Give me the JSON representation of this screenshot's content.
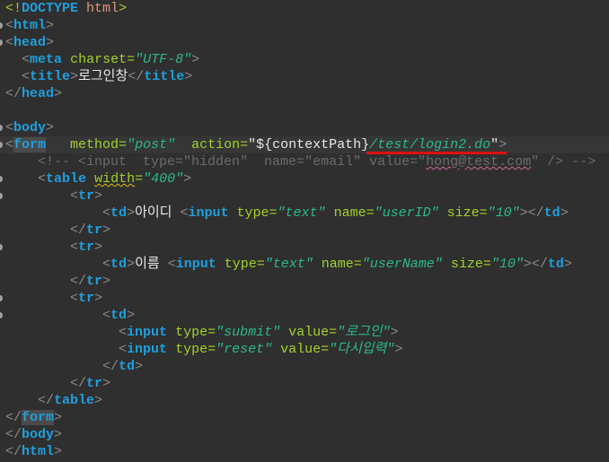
{
  "editor": {
    "current_line": 8,
    "fold_lines": [
      1,
      2,
      7,
      8,
      10,
      11,
      14,
      17,
      18
    ],
    "annotation": {
      "type": "red-underline",
      "color": "#e01010",
      "target": "/test/login2.do"
    },
    "colors": {
      "background": "#2f2f2f",
      "tag": "#1ea0de",
      "attribute": "#a3d12a",
      "value": "#2cb98e",
      "comment": "#6c6c6c",
      "bracket": "#8a8a8a"
    },
    "lines": [
      [
        [
          "dt1",
          "<!"
        ],
        [
          "dt2",
          "DOCTYPE"
        ],
        [
          "txt",
          " "
        ],
        [
          "dt3",
          "html"
        ],
        [
          "dt1",
          ">"
        ]
      ],
      [
        [
          "br",
          "<"
        ],
        [
          "tag",
          "html"
        ],
        [
          "br",
          ">"
        ]
      ],
      [
        [
          "br",
          "<"
        ],
        [
          "tag",
          "head"
        ],
        [
          "br",
          ">"
        ]
      ],
      [
        [
          "txt",
          "  "
        ],
        [
          "br",
          "<"
        ],
        [
          "tag",
          "meta"
        ],
        [
          "txt",
          " "
        ],
        [
          "attr",
          "charset="
        ],
        [
          "val",
          "\"UTF-8\""
        ],
        [
          "br",
          ">"
        ]
      ],
      [
        [
          "txt",
          "  "
        ],
        [
          "br",
          "<"
        ],
        [
          "tag",
          "title"
        ],
        [
          "br",
          ">"
        ],
        [
          "txt",
          "로그인창"
        ],
        [
          "br",
          "</"
        ],
        [
          "tag",
          "title"
        ],
        [
          "br",
          ">"
        ]
      ],
      [
        [
          "br",
          "</"
        ],
        [
          "tag",
          "head"
        ],
        [
          "br",
          ">"
        ]
      ],
      [],
      [
        [
          "br",
          "<"
        ],
        [
          "tag",
          "body"
        ],
        [
          "br",
          ">"
        ]
      ],
      [
        [
          "br",
          "<"
        ],
        [
          "tag match",
          "form"
        ],
        [
          "txt",
          "   "
        ],
        [
          "attr",
          "method="
        ],
        [
          "val",
          "\"post\""
        ],
        [
          "txt",
          "  "
        ],
        [
          "attr",
          "action="
        ],
        [
          "txt",
          "\"${contextPath}"
        ],
        [
          "val",
          "/test/login2.do"
        ],
        [
          "txt",
          "\""
        ],
        [
          "br",
          ">"
        ]
      ],
      [
        [
          "txt",
          "    "
        ],
        [
          "cm",
          "<!-- <input  type=\"hidden\"  name=\"email\" value=\""
        ],
        [
          "cm wavy-p",
          "hong@test.com"
        ],
        [
          "cm",
          "\" /> -->"
        ]
      ],
      [
        [
          "txt",
          "    "
        ],
        [
          "br",
          "<"
        ],
        [
          "tag",
          "table"
        ],
        [
          "txt",
          " "
        ],
        [
          "attr wavy-y",
          "width"
        ],
        [
          "attr",
          "="
        ],
        [
          "val",
          "\"400\""
        ],
        [
          "br",
          ">"
        ]
      ],
      [
        [
          "txt",
          "        "
        ],
        [
          "br",
          "<"
        ],
        [
          "tag",
          "tr"
        ],
        [
          "br",
          ">"
        ]
      ],
      [
        [
          "txt",
          "            "
        ],
        [
          "br",
          "<"
        ],
        [
          "tag",
          "td"
        ],
        [
          "br",
          ">"
        ],
        [
          "txt",
          "아이디 "
        ],
        [
          "br",
          "<"
        ],
        [
          "tag",
          "input"
        ],
        [
          "txt",
          " "
        ],
        [
          "attr",
          "type="
        ],
        [
          "val",
          "\"text\""
        ],
        [
          "txt",
          " "
        ],
        [
          "attr",
          "name="
        ],
        [
          "val",
          "\"userID\""
        ],
        [
          "txt",
          " "
        ],
        [
          "attr",
          "size="
        ],
        [
          "val",
          "\"10\""
        ],
        [
          "br",
          "></"
        ],
        [
          "tag",
          "td"
        ],
        [
          "br",
          ">"
        ]
      ],
      [
        [
          "txt",
          "        "
        ],
        [
          "br",
          "</"
        ],
        [
          "tag",
          "tr"
        ],
        [
          "br",
          ">"
        ]
      ],
      [
        [
          "txt",
          "        "
        ],
        [
          "br",
          "<"
        ],
        [
          "tag",
          "tr"
        ],
        [
          "br",
          ">"
        ]
      ],
      [
        [
          "txt",
          "            "
        ],
        [
          "br",
          "<"
        ],
        [
          "tag",
          "td"
        ],
        [
          "br",
          ">"
        ],
        [
          "txt",
          "이름 "
        ],
        [
          "br",
          "<"
        ],
        [
          "tag",
          "input"
        ],
        [
          "txt",
          " "
        ],
        [
          "attr",
          "type="
        ],
        [
          "val",
          "\"text\""
        ],
        [
          "txt",
          " "
        ],
        [
          "attr",
          "name="
        ],
        [
          "val",
          "\"userName\""
        ],
        [
          "txt",
          " "
        ],
        [
          "attr",
          "size="
        ],
        [
          "val",
          "\"10\""
        ],
        [
          "br",
          "></"
        ],
        [
          "tag",
          "td"
        ],
        [
          "br",
          ">"
        ]
      ],
      [
        [
          "txt",
          "        "
        ],
        [
          "br",
          "</"
        ],
        [
          "tag",
          "tr"
        ],
        [
          "br",
          ">"
        ]
      ],
      [
        [
          "txt",
          "        "
        ],
        [
          "br",
          "<"
        ],
        [
          "tag",
          "tr"
        ],
        [
          "br",
          ">"
        ]
      ],
      [
        [
          "txt",
          "            "
        ],
        [
          "br",
          "<"
        ],
        [
          "tag",
          "td"
        ],
        [
          "br",
          ">"
        ]
      ],
      [
        [
          "txt",
          "              "
        ],
        [
          "br",
          "<"
        ],
        [
          "tag",
          "input"
        ],
        [
          "txt",
          " "
        ],
        [
          "attr",
          "type="
        ],
        [
          "val",
          "\"submit\""
        ],
        [
          "txt",
          " "
        ],
        [
          "attr",
          "value="
        ],
        [
          "val",
          "\"로그인\""
        ],
        [
          "br",
          ">"
        ]
      ],
      [
        [
          "txt",
          "              "
        ],
        [
          "br",
          "<"
        ],
        [
          "tag",
          "input"
        ],
        [
          "txt",
          " "
        ],
        [
          "attr",
          "type="
        ],
        [
          "val",
          "\"reset\""
        ],
        [
          "txt",
          " "
        ],
        [
          "attr",
          "value="
        ],
        [
          "val",
          "\"다시입력\""
        ],
        [
          "br",
          ">"
        ]
      ],
      [
        [
          "txt",
          "            "
        ],
        [
          "br",
          "</"
        ],
        [
          "tag",
          "td"
        ],
        [
          "br",
          ">"
        ]
      ],
      [
        [
          "txt",
          "        "
        ],
        [
          "br",
          "</"
        ],
        [
          "tag",
          "tr"
        ],
        [
          "br",
          ">"
        ]
      ],
      [
        [
          "txt",
          "    "
        ],
        [
          "br",
          "</"
        ],
        [
          "tag",
          "table"
        ],
        [
          "br",
          ">"
        ]
      ],
      [
        [
          "br",
          "</"
        ],
        [
          "tag match",
          "form"
        ],
        [
          "br",
          ">"
        ]
      ],
      [
        [
          "br",
          "</"
        ],
        [
          "tag",
          "body"
        ],
        [
          "br",
          ">"
        ]
      ],
      [
        [
          "br",
          "</"
        ],
        [
          "tag",
          "html"
        ],
        [
          "br",
          ">"
        ]
      ]
    ]
  }
}
